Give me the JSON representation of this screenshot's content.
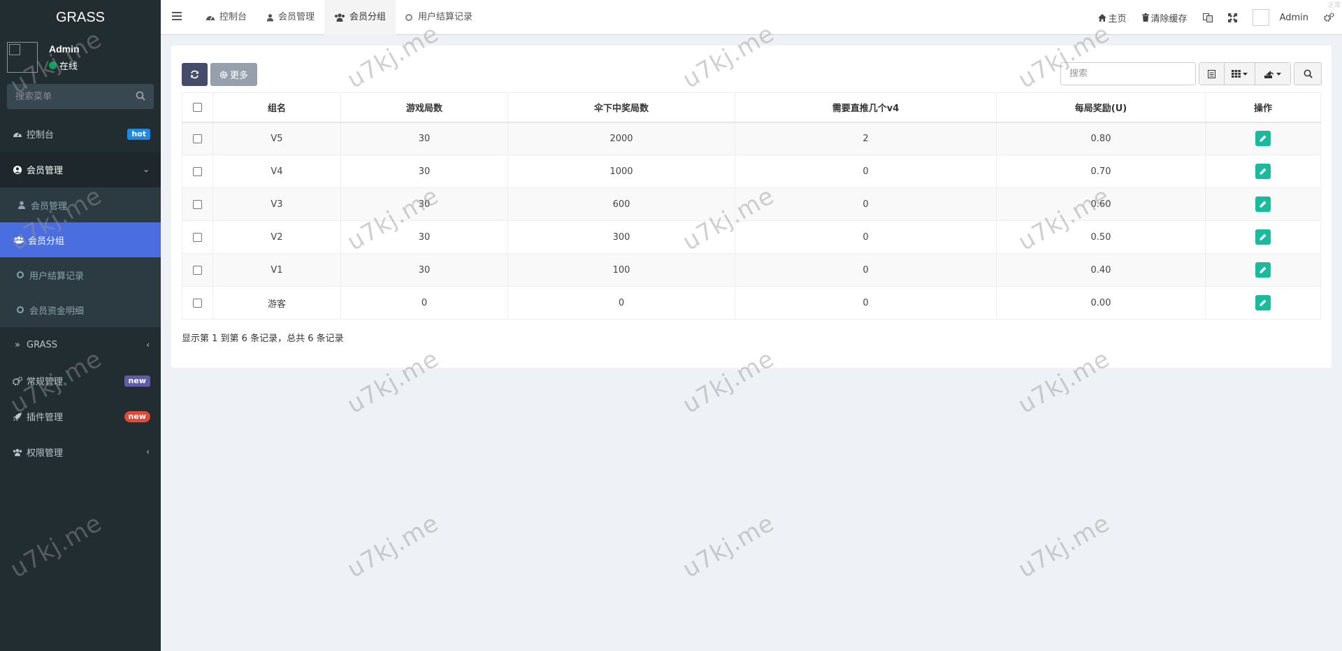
{
  "sidebar": {
    "logo": "GRASS",
    "user": {
      "name": "Admin",
      "status": "在线"
    },
    "search_placeholder": "搜索菜单",
    "menu": [
      {
        "label": "控制台",
        "badge": "hot"
      },
      {
        "label": "会员管理"
      },
      {
        "label": "会员管理"
      },
      {
        "label": "会员分组"
      },
      {
        "label": "用户结算记录"
      },
      {
        "label": "会员资金明细"
      },
      {
        "label": "GRASS"
      },
      {
        "label": "常规管理",
        "badge": "new"
      },
      {
        "label": "插件管理",
        "badge": "new"
      },
      {
        "label": "权限管理"
      }
    ]
  },
  "topnav": {
    "tabs": [
      {
        "label": "控制台"
      },
      {
        "label": "会员管理"
      },
      {
        "label": "会员分组"
      },
      {
        "label": "用户结算记录"
      }
    ],
    "home": "主页",
    "clear_cache": "清除缓存",
    "admin": "Admin",
    "corner": "正常"
  },
  "toolbar": {
    "more": "更多",
    "search_placeholder": "搜索"
  },
  "table": {
    "headers": [
      "组名",
      "游戏局数",
      "伞下中奖局数",
      "需要直推几个v4",
      "每局奖励(U)",
      "操作"
    ],
    "rows": [
      [
        "V5",
        "30",
        "2000",
        "2",
        "0.80"
      ],
      [
        "V4",
        "30",
        "1000",
        "0",
        "0.70"
      ],
      [
        "V3",
        "30",
        "600",
        "0",
        "0.60"
      ],
      [
        "V2",
        "30",
        "300",
        "0",
        "0.50"
      ],
      [
        "V1",
        "30",
        "100",
        "0",
        "0.40"
      ],
      [
        "游客",
        "0",
        "0",
        "0",
        "0.00"
      ]
    ],
    "footer": "显示第 1 到第 6 条记录，总共 6 条记录"
  },
  "watermark": "u7kj.me",
  "colors": {
    "sidebar": "#222d32",
    "active": "#4a6ee0",
    "edit": "#18bc9c",
    "hot": "#1e88e5",
    "new": "#605ca8",
    "new_red": "#dd4b39"
  }
}
